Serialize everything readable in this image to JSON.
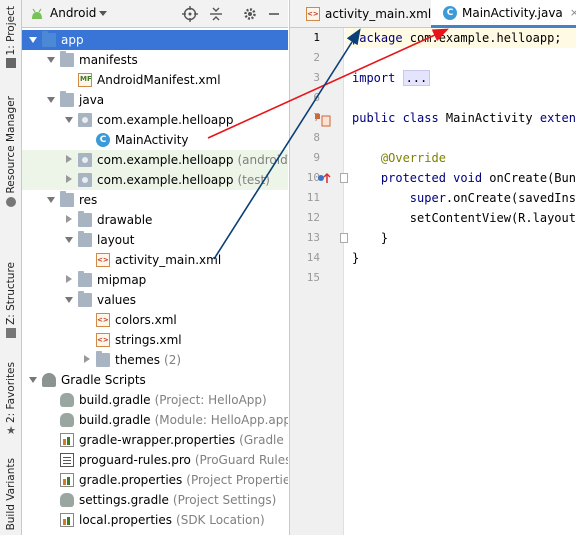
{
  "side_tabs": {
    "project": "1: Project",
    "resource_manager": "Resource Manager",
    "structure": "Z: Structure",
    "favorites": "2: Favorites",
    "build_variants": "Build Variants"
  },
  "project_toolbar": {
    "view_selector": "Android",
    "icons": [
      "android-icon",
      "crosshair-icon",
      "collapse-icon",
      "gear-icon",
      "minimize-icon"
    ]
  },
  "tree": [
    {
      "label": "app",
      "secondary": "",
      "indent": 0,
      "expanded": "down",
      "icon": "folder-app-icon",
      "selected": true
    },
    {
      "label": "manifests",
      "secondary": "",
      "indent": 1,
      "expanded": "down",
      "icon": "folder-icon"
    },
    {
      "label": "AndroidManifest.xml",
      "secondary": "",
      "indent": 2,
      "expanded": "",
      "icon": "manifest-icon"
    },
    {
      "label": "java",
      "secondary": "",
      "indent": 1,
      "expanded": "down",
      "icon": "folder-icon"
    },
    {
      "label": "com.example.helloapp",
      "secondary": "",
      "indent": 2,
      "expanded": "down",
      "icon": "package-icon"
    },
    {
      "label": "MainActivity",
      "secondary": "",
      "indent": 3,
      "expanded": "",
      "icon": "class-icon"
    },
    {
      "label": "com.example.helloapp",
      "secondary": "(androidTest)",
      "indent": 2,
      "expanded": "right",
      "icon": "package-icon",
      "tinted": true
    },
    {
      "label": "com.example.helloapp",
      "secondary": "(test)",
      "indent": 2,
      "expanded": "right",
      "icon": "package-icon",
      "tinted": true
    },
    {
      "label": "res",
      "secondary": "",
      "indent": 1,
      "expanded": "down",
      "icon": "res-folder-icon"
    },
    {
      "label": "drawable",
      "secondary": "",
      "indent": 2,
      "expanded": "right",
      "icon": "folder-icon"
    },
    {
      "label": "layout",
      "secondary": "",
      "indent": 2,
      "expanded": "down",
      "icon": "folder-icon"
    },
    {
      "label": "activity_main.xml",
      "secondary": "",
      "indent": 3,
      "expanded": "",
      "icon": "xml-icon"
    },
    {
      "label": "mipmap",
      "secondary": "",
      "indent": 2,
      "expanded": "right",
      "icon": "folder-icon"
    },
    {
      "label": "values",
      "secondary": "",
      "indent": 2,
      "expanded": "down",
      "icon": "folder-icon"
    },
    {
      "label": "colors.xml",
      "secondary": "",
      "indent": 3,
      "expanded": "",
      "icon": "xml-icon"
    },
    {
      "label": "strings.xml",
      "secondary": "",
      "indent": 3,
      "expanded": "",
      "icon": "xml-icon"
    },
    {
      "label": "themes",
      "secondary": "(2)",
      "indent": 3,
      "expanded": "right",
      "icon": "folder-icon"
    },
    {
      "label": "Gradle Scripts",
      "secondary": "",
      "indent": 0,
      "expanded": "down",
      "icon": "gradle-scripts-icon"
    },
    {
      "label": "build.gradle",
      "secondary": "(Project: HelloApp)",
      "indent": 1,
      "expanded": "",
      "icon": "gradle-icon"
    },
    {
      "label": "build.gradle",
      "secondary": "(Module: HelloApp.app)",
      "indent": 1,
      "expanded": "",
      "icon": "gradle-icon"
    },
    {
      "label": "gradle-wrapper.properties",
      "secondary": "(Gradle Version)",
      "indent": 1,
      "expanded": "",
      "icon": "properties-icon"
    },
    {
      "label": "proguard-rules.pro",
      "secondary": "(ProGuard Rules for",
      "indent": 1,
      "expanded": "",
      "icon": "pro-file-icon"
    },
    {
      "label": "gradle.properties",
      "secondary": "(Project Properties)",
      "indent": 1,
      "expanded": "",
      "icon": "properties-icon"
    },
    {
      "label": "settings.gradle",
      "secondary": "(Project Settings)",
      "indent": 1,
      "expanded": "",
      "icon": "gradle-icon"
    },
    {
      "label": "local.properties",
      "secondary": "(SDK Location)",
      "indent": 1,
      "expanded": "",
      "icon": "properties-icon"
    }
  ],
  "editor_tabs": [
    {
      "label": "activity_main.xml",
      "icon": "xml-icon",
      "active": false,
      "close": "×"
    },
    {
      "label": "MainActivity.java",
      "icon": "class-icon",
      "active": true,
      "close": "×"
    }
  ],
  "code": {
    "lines": [
      {
        "num": "1",
        "tokens": [
          {
            "t": "package ",
            "c": "kw"
          },
          {
            "t": "com.example.helloapp;",
            "c": ""
          }
        ]
      },
      {
        "num": "2",
        "tokens": []
      },
      {
        "num": "3",
        "tokens": [
          {
            "t": "import ",
            "c": "kw"
          },
          {
            "t": "...",
            "c": "fold"
          }
        ]
      },
      {
        "num": "6",
        "tokens": []
      },
      {
        "num": "7",
        "tokens": [
          {
            "t": "public class ",
            "c": "kw"
          },
          {
            "t": "MainActivity ",
            "c": ""
          },
          {
            "t": "extends",
            "c": "kw"
          }
        ]
      },
      {
        "num": "8",
        "tokens": []
      },
      {
        "num": "9",
        "tokens": [
          {
            "t": "    @Override",
            "c": "anno"
          }
        ]
      },
      {
        "num": "10",
        "tokens": [
          {
            "t": "    protected void ",
            "c": "kw"
          },
          {
            "t": "onCreate(Bundle",
            "c": ""
          }
        ]
      },
      {
        "num": "11",
        "tokens": [
          {
            "t": "        super",
            "c": "kw"
          },
          {
            "t": ".onCreate(savedInst",
            "c": ""
          }
        ]
      },
      {
        "num": "12",
        "tokens": [
          {
            "t": "        setContentView(R.layout.a",
            "c": ""
          }
        ]
      },
      {
        "num": "13",
        "tokens": [
          {
            "t": "    }",
            "c": ""
          }
        ]
      },
      {
        "num": "14",
        "tokens": [
          {
            "t": "}",
            "c": ""
          }
        ]
      },
      {
        "num": "15",
        "tokens": []
      }
    ]
  },
  "colors": {
    "selection": "#3875d7",
    "annotation_arrow_red": "#e8141a",
    "annotation_arrow_blue": "#0a3f78",
    "active_tab_underline": "#4083c9"
  }
}
